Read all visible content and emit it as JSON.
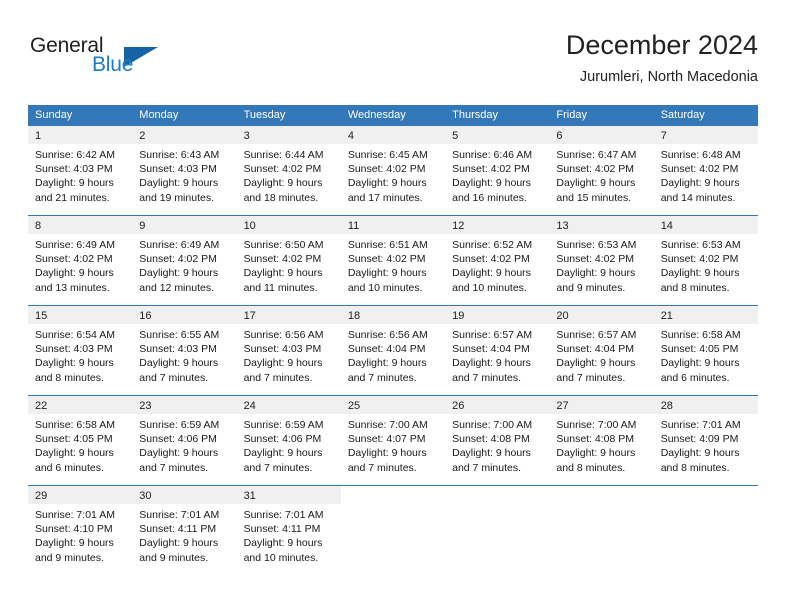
{
  "brand": {
    "name_part1": "General",
    "name_part2": "Blue",
    "triangle_icon": "triangle-icon"
  },
  "header": {
    "title": "December 2024",
    "subtitle": "Jurumleri, North Macedonia"
  },
  "colors": {
    "header_blue": "#3378b8",
    "brand_blue": "#1d7dc4",
    "day_band_gray": "#f0f0f0"
  },
  "calendar": {
    "weekdays": [
      "Sunday",
      "Monday",
      "Tuesday",
      "Wednesday",
      "Thursday",
      "Friday",
      "Saturday"
    ],
    "weeks": [
      [
        {
          "day": "1",
          "sunrise": "Sunrise: 6:42 AM",
          "sunset": "Sunset: 4:03 PM",
          "daylight1": "Daylight: 9 hours",
          "daylight2": "and 21 minutes."
        },
        {
          "day": "2",
          "sunrise": "Sunrise: 6:43 AM",
          "sunset": "Sunset: 4:03 PM",
          "daylight1": "Daylight: 9 hours",
          "daylight2": "and 19 minutes."
        },
        {
          "day": "3",
          "sunrise": "Sunrise: 6:44 AM",
          "sunset": "Sunset: 4:02 PM",
          "daylight1": "Daylight: 9 hours",
          "daylight2": "and 18 minutes."
        },
        {
          "day": "4",
          "sunrise": "Sunrise: 6:45 AM",
          "sunset": "Sunset: 4:02 PM",
          "daylight1": "Daylight: 9 hours",
          "daylight2": "and 17 minutes."
        },
        {
          "day": "5",
          "sunrise": "Sunrise: 6:46 AM",
          "sunset": "Sunset: 4:02 PM",
          "daylight1": "Daylight: 9 hours",
          "daylight2": "and 16 minutes."
        },
        {
          "day": "6",
          "sunrise": "Sunrise: 6:47 AM",
          "sunset": "Sunset: 4:02 PM",
          "daylight1": "Daylight: 9 hours",
          "daylight2": "and 15 minutes."
        },
        {
          "day": "7",
          "sunrise": "Sunrise: 6:48 AM",
          "sunset": "Sunset: 4:02 PM",
          "daylight1": "Daylight: 9 hours",
          "daylight2": "and 14 minutes."
        }
      ],
      [
        {
          "day": "8",
          "sunrise": "Sunrise: 6:49 AM",
          "sunset": "Sunset: 4:02 PM",
          "daylight1": "Daylight: 9 hours",
          "daylight2": "and 13 minutes."
        },
        {
          "day": "9",
          "sunrise": "Sunrise: 6:49 AM",
          "sunset": "Sunset: 4:02 PM",
          "daylight1": "Daylight: 9 hours",
          "daylight2": "and 12 minutes."
        },
        {
          "day": "10",
          "sunrise": "Sunrise: 6:50 AM",
          "sunset": "Sunset: 4:02 PM",
          "daylight1": "Daylight: 9 hours",
          "daylight2": "and 11 minutes."
        },
        {
          "day": "11",
          "sunrise": "Sunrise: 6:51 AM",
          "sunset": "Sunset: 4:02 PM",
          "daylight1": "Daylight: 9 hours",
          "daylight2": "and 10 minutes."
        },
        {
          "day": "12",
          "sunrise": "Sunrise: 6:52 AM",
          "sunset": "Sunset: 4:02 PM",
          "daylight1": "Daylight: 9 hours",
          "daylight2": "and 10 minutes."
        },
        {
          "day": "13",
          "sunrise": "Sunrise: 6:53 AM",
          "sunset": "Sunset: 4:02 PM",
          "daylight1": "Daylight: 9 hours",
          "daylight2": "and 9 minutes."
        },
        {
          "day": "14",
          "sunrise": "Sunrise: 6:53 AM",
          "sunset": "Sunset: 4:02 PM",
          "daylight1": "Daylight: 9 hours",
          "daylight2": "and 8 minutes."
        }
      ],
      [
        {
          "day": "15",
          "sunrise": "Sunrise: 6:54 AM",
          "sunset": "Sunset: 4:03 PM",
          "daylight1": "Daylight: 9 hours",
          "daylight2": "and 8 minutes."
        },
        {
          "day": "16",
          "sunrise": "Sunrise: 6:55 AM",
          "sunset": "Sunset: 4:03 PM",
          "daylight1": "Daylight: 9 hours",
          "daylight2": "and 7 minutes."
        },
        {
          "day": "17",
          "sunrise": "Sunrise: 6:56 AM",
          "sunset": "Sunset: 4:03 PM",
          "daylight1": "Daylight: 9 hours",
          "daylight2": "and 7 minutes."
        },
        {
          "day": "18",
          "sunrise": "Sunrise: 6:56 AM",
          "sunset": "Sunset: 4:04 PM",
          "daylight1": "Daylight: 9 hours",
          "daylight2": "and 7 minutes."
        },
        {
          "day": "19",
          "sunrise": "Sunrise: 6:57 AM",
          "sunset": "Sunset: 4:04 PM",
          "daylight1": "Daylight: 9 hours",
          "daylight2": "and 7 minutes."
        },
        {
          "day": "20",
          "sunrise": "Sunrise: 6:57 AM",
          "sunset": "Sunset: 4:04 PM",
          "daylight1": "Daylight: 9 hours",
          "daylight2": "and 7 minutes."
        },
        {
          "day": "21",
          "sunrise": "Sunrise: 6:58 AM",
          "sunset": "Sunset: 4:05 PM",
          "daylight1": "Daylight: 9 hours",
          "daylight2": "and 6 minutes."
        }
      ],
      [
        {
          "day": "22",
          "sunrise": "Sunrise: 6:58 AM",
          "sunset": "Sunset: 4:05 PM",
          "daylight1": "Daylight: 9 hours",
          "daylight2": "and 6 minutes."
        },
        {
          "day": "23",
          "sunrise": "Sunrise: 6:59 AM",
          "sunset": "Sunset: 4:06 PM",
          "daylight1": "Daylight: 9 hours",
          "daylight2": "and 7 minutes."
        },
        {
          "day": "24",
          "sunrise": "Sunrise: 6:59 AM",
          "sunset": "Sunset: 4:06 PM",
          "daylight1": "Daylight: 9 hours",
          "daylight2": "and 7 minutes."
        },
        {
          "day": "25",
          "sunrise": "Sunrise: 7:00 AM",
          "sunset": "Sunset: 4:07 PM",
          "daylight1": "Daylight: 9 hours",
          "daylight2": "and 7 minutes."
        },
        {
          "day": "26",
          "sunrise": "Sunrise: 7:00 AM",
          "sunset": "Sunset: 4:08 PM",
          "daylight1": "Daylight: 9 hours",
          "daylight2": "and 7 minutes."
        },
        {
          "day": "27",
          "sunrise": "Sunrise: 7:00 AM",
          "sunset": "Sunset: 4:08 PM",
          "daylight1": "Daylight: 9 hours",
          "daylight2": "and 8 minutes."
        },
        {
          "day": "28",
          "sunrise": "Sunrise: 7:01 AM",
          "sunset": "Sunset: 4:09 PM",
          "daylight1": "Daylight: 9 hours",
          "daylight2": "and 8 minutes."
        }
      ],
      [
        {
          "day": "29",
          "sunrise": "Sunrise: 7:01 AM",
          "sunset": "Sunset: 4:10 PM",
          "daylight1": "Daylight: 9 hours",
          "daylight2": "and 9 minutes."
        },
        {
          "day": "30",
          "sunrise": "Sunrise: 7:01 AM",
          "sunset": "Sunset: 4:11 PM",
          "daylight1": "Daylight: 9 hours",
          "daylight2": "and 9 minutes."
        },
        {
          "day": "31",
          "sunrise": "Sunrise: 7:01 AM",
          "sunset": "Sunset: 4:11 PM",
          "daylight1": "Daylight: 9 hours",
          "daylight2": "and 10 minutes."
        },
        {
          "day": "",
          "sunrise": "",
          "sunset": "",
          "daylight1": "",
          "daylight2": ""
        },
        {
          "day": "",
          "sunrise": "",
          "sunset": "",
          "daylight1": "",
          "daylight2": ""
        },
        {
          "day": "",
          "sunrise": "",
          "sunset": "",
          "daylight1": "",
          "daylight2": ""
        },
        {
          "day": "",
          "sunrise": "",
          "sunset": "",
          "daylight1": "",
          "daylight2": ""
        }
      ]
    ]
  }
}
